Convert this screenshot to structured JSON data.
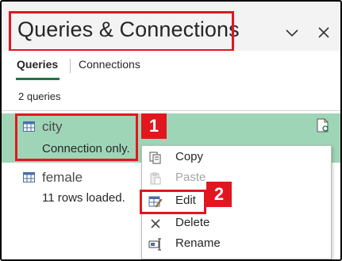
{
  "panel": {
    "title": "Queries & Connections",
    "tabs": [
      {
        "label": "Queries",
        "active": true
      },
      {
        "label": "Connections",
        "active": false
      }
    ],
    "query_count": "2 queries"
  },
  "queries": [
    {
      "name": "city",
      "status": "Connection only.",
      "selected": true
    },
    {
      "name": "female",
      "status": "11 rows loaded.",
      "selected": false
    }
  ],
  "context_menu": {
    "items": [
      {
        "label": "Copy",
        "icon": "copy-icon",
        "enabled": true
      },
      {
        "label": "Paste",
        "icon": "paste-icon",
        "enabled": false
      },
      {
        "label": "Edit",
        "icon": "edit-icon",
        "enabled": true
      },
      {
        "label": "Delete",
        "icon": "delete-icon",
        "enabled": true
      },
      {
        "label": "Rename",
        "icon": "rename-icon",
        "enabled": true
      }
    ]
  },
  "annotations": {
    "step1": "1",
    "step2": "2"
  },
  "colors": {
    "accent_green": "#217346",
    "selected_row": "#9fd5b7",
    "highlight_red": "#e2161f"
  }
}
